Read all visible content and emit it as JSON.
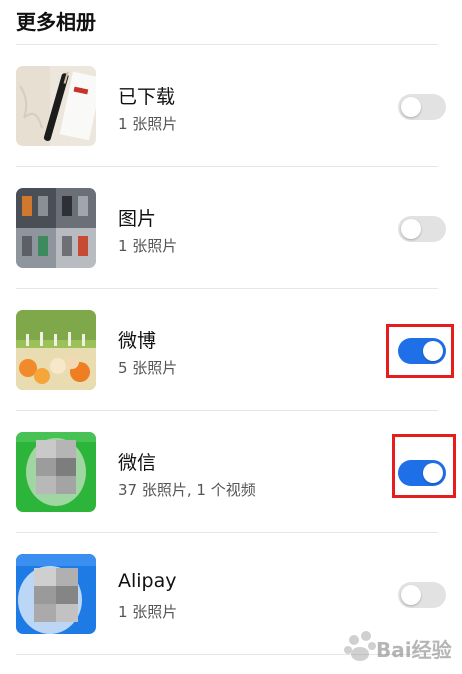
{
  "header": {
    "title": "更多相册"
  },
  "albums": [
    {
      "name": "已下载",
      "count": "1 张照片",
      "enabled": false,
      "thumb_icon": "downloaded-thumbnail"
    },
    {
      "name": "图片",
      "count": "1 张照片",
      "enabled": false,
      "thumb_icon": "chairs-grid-thumbnail"
    },
    {
      "name": "微博",
      "count": "5 张照片",
      "enabled": true,
      "thumb_icon": "weibo-illustration-thumbnail"
    },
    {
      "name": "微信",
      "count": "37 张照片, 1 个视频",
      "enabled": true,
      "thumb_icon": "wechat-blurred-thumbnail"
    },
    {
      "name": "Alipay",
      "count": "1 张照片",
      "enabled": false,
      "thumb_icon": "alipay-blurred-thumbnail"
    }
  ],
  "watermark": {
    "text": "Bai经验"
  },
  "colors": {
    "toggle_on": "#1f6fe8",
    "toggle_off": "#e2e2e2",
    "highlight": "#e51d1d"
  }
}
